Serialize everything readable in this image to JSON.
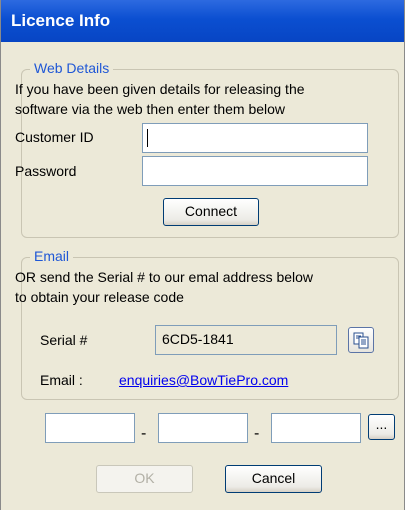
{
  "window": {
    "title": "Licence Info"
  },
  "web_details": {
    "legend": "Web Details",
    "description_line1": "If you have been given details for releasing the",
    "description_line2": "software via the web then enter them below",
    "customer_id_label": "Customer ID",
    "customer_id_value": "",
    "password_label": "Password",
    "password_value": "",
    "connect_label": "Connect"
  },
  "email": {
    "legend": "Email",
    "description_line1": "OR send the Serial # to our emal address below",
    "description_line2": "to obtain your release code",
    "serial_label": "Serial #",
    "serial_value": "6CD5-1841",
    "email_label": "Email :",
    "email_address": "enquiries@BowTiePro.com",
    "copy_icon": "copy-clipboard-icon"
  },
  "release_code": {
    "part1": "",
    "part2": "",
    "part3": "",
    "separator": "-",
    "browse_label": "..."
  },
  "buttons": {
    "ok_label": "OK",
    "cancel_label": "Cancel"
  },
  "colors": {
    "title_bar": "#0b4fd1",
    "legend": "#1f57d6",
    "link": "#0000ee",
    "panel": "#ece9d8"
  }
}
